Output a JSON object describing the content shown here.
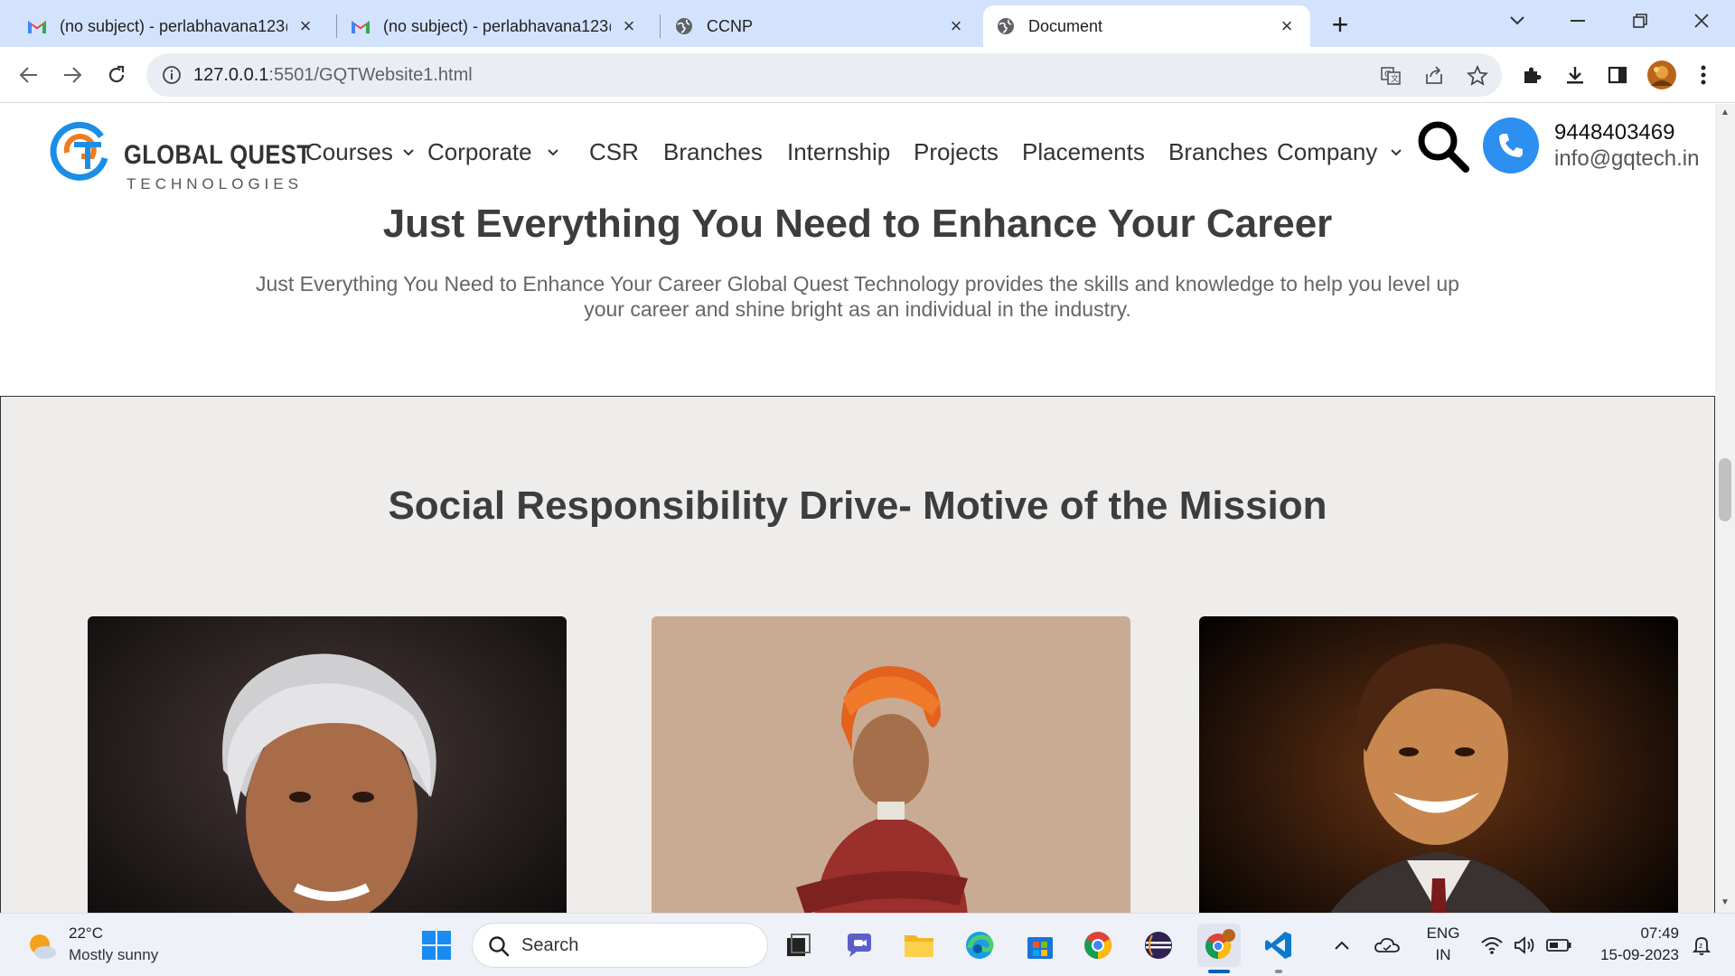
{
  "browser": {
    "tabs": [
      {
        "title": "(no subject) - perlabhavana123@",
        "icon": "gmail-icon"
      },
      {
        "title": "(no subject) - perlabhavana123@",
        "icon": "gmail-icon"
      },
      {
        "title": "CCNP",
        "icon": "globe-icon"
      },
      {
        "title": "Document",
        "icon": "globe-icon",
        "active": true
      }
    ],
    "url_host": "127.0.0.1",
    "url_rest": ":5501/GQTWebsite1.html"
  },
  "site": {
    "logo": {
      "name": "GLOBAL QUEST",
      "sub": "TECHNOLOGIES",
      "mark": "GT"
    },
    "menu": [
      {
        "label": "Courses",
        "dropdown": true
      },
      {
        "label": "Corporate",
        "dropdown": true
      },
      {
        "label": "CSR",
        "dropdown": false
      },
      {
        "label": "Branches",
        "dropdown": false
      },
      {
        "label": "Internship",
        "dropdown": false
      },
      {
        "label": "Projects",
        "dropdown": false
      },
      {
        "label": "Placements",
        "dropdown": false
      },
      {
        "label": "Branches",
        "dropdown": false
      },
      {
        "label": "Company",
        "dropdown": true
      }
    ],
    "contact": {
      "phone": "9448403469",
      "email": "info@gqtech.in"
    },
    "hero": {
      "title": "Just Everything You Need to Enhance Your Career",
      "text": "Just Everything You Need to Enhance Your Career Global Quest Technology provides the skills and knowledge to help you level up your career and shine bright as an individual in the industry."
    },
    "csr": {
      "title": "Social Responsibility Drive- Motive of the Mission",
      "cards": [
        "portrait-white-hair",
        "portrait-saffron-turban",
        "portrait-smiling-man"
      ]
    }
  },
  "taskbar": {
    "weather": {
      "temp": "22°C",
      "desc": "Mostly sunny"
    },
    "search_label": "Search",
    "lang_top": "ENG",
    "lang_bottom": "IN",
    "time": "07:49",
    "date": "15-09-2023"
  },
  "colors": {
    "accent": "#2d8ff0",
    "logo_orange": "#f07b1d",
    "logo_blue": "#1b8ee6",
    "tabbar": "#d3e3fd",
    "csr_bg": "#eeedeb"
  }
}
